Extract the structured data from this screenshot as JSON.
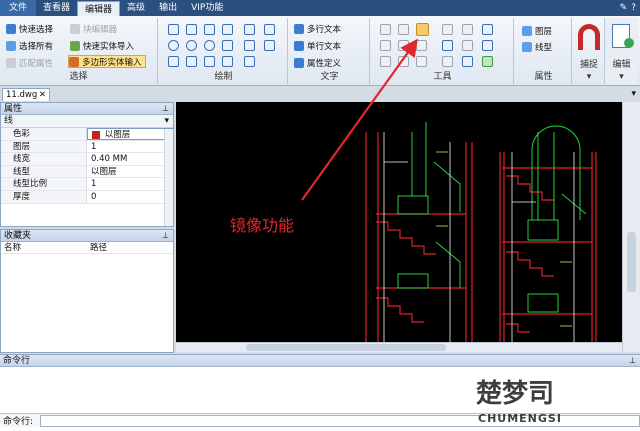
{
  "menubar": {
    "tabs": [
      "文件",
      "查看器",
      "编辑器",
      "高级",
      "输出",
      "VIP功能"
    ],
    "active_index": 2
  },
  "ribbon": {
    "select_group": {
      "label": "选择",
      "items": [
        "快速选择",
        "选择所有",
        "匹配属性",
        "块编辑器",
        "快速实体导入",
        "多边形实体输入"
      ]
    },
    "draw_group": {
      "label": "绘制"
    },
    "text_group": {
      "label": "文字",
      "items": [
        "多行文本",
        "单行文本",
        "属性定义"
      ]
    },
    "tools_group": {
      "label": "工具"
    },
    "props_group": {
      "label": "属性",
      "items": [
        "图层",
        "线型"
      ]
    },
    "big_buttons": [
      "捕捉",
      "编辑"
    ]
  },
  "document_tab": {
    "name": "11.dwg"
  },
  "properties_panel": {
    "title": "属性",
    "category": "线",
    "rows": [
      {
        "key": "色彩",
        "value": "以图层"
      },
      {
        "key": "图层",
        "value": "1"
      },
      {
        "key": "线宽",
        "value": "0.40 MM"
      },
      {
        "key": "线型",
        "value": "以图层"
      },
      {
        "key": "线型比例",
        "value": "1"
      },
      {
        "key": "厚度",
        "value": "0"
      }
    ],
    "color_swatch": "#cc1f1f"
  },
  "favorites_panel": {
    "title": "收藏夹",
    "columns": [
      "名称",
      "路径"
    ]
  },
  "command_panel": {
    "title": "命令行",
    "input_label": "命令行:"
  },
  "annotation": {
    "text": "镜像功能",
    "color": "#e0282c"
  },
  "watermark": {
    "line1": "楚梦",
    "line2": "CHUMENGSI"
  }
}
